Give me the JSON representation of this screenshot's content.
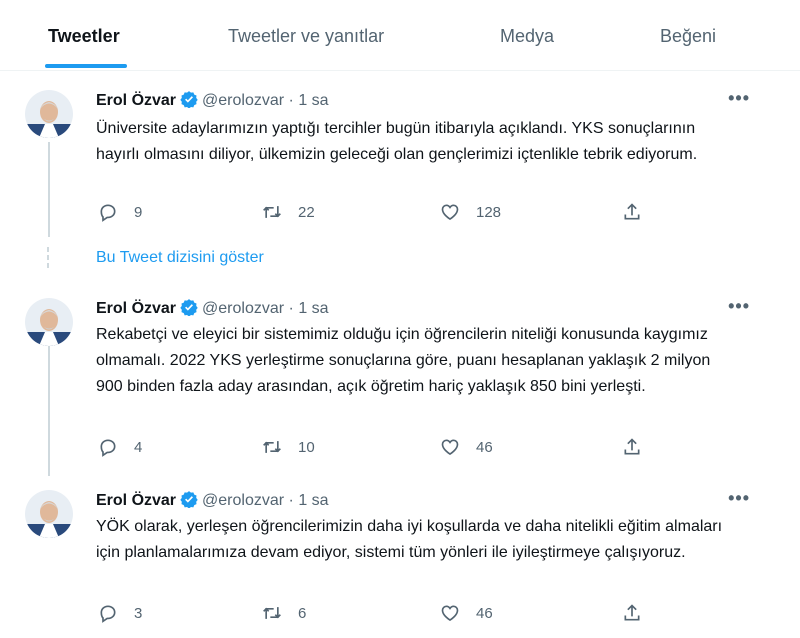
{
  "tabs": [
    {
      "label": "Tweetler",
      "active": true
    },
    {
      "label": "Tweetler ve yanıtlar",
      "active": false
    },
    {
      "label": "Medya",
      "active": false
    },
    {
      "label": "Beğeni",
      "active": false
    }
  ],
  "show_thread_label": "Bu Tweet dizisini göster",
  "more_label": "•••",
  "tweets": [
    {
      "author": "Erol Özvar",
      "handle": "@erolozvar",
      "sep": "·",
      "time": "1 sa",
      "text": "Üniversite adaylarımızın yaptığı tercihler bugün itibarıyla açıklandı. YKS sonuçlarının hayırlı olmasını diliyor, ülkemizin geleceği olan gençlerimizi içtenlikle tebrik ediyorum.",
      "replies": "9",
      "retweets": "22",
      "likes": "128"
    },
    {
      "author": "Erol Özvar",
      "handle": "@erolozvar",
      "sep": "·",
      "time": "1 sa",
      "text": "Rekabetçi ve eleyici bir sistemimiz olduğu için öğrencilerin niteliği konusunda kaygımız olmamalı. 2022 YKS yerleştirme sonuçlarına göre, puanı hesaplanan yaklaşık 2 milyon 900 binden fazla aday arasından, açık öğretim hariç yaklaşık 850 bini yerleşti.",
      "replies": "4",
      "retweets": "10",
      "likes": "46"
    },
    {
      "author": "Erol Özvar",
      "handle": "@erolozvar",
      "sep": "·",
      "time": "1 sa",
      "text": "YÖK olarak, yerleşen öğrencilerimizin daha iyi koşullarda ve daha nitelikli eğitim almaları için planlamalarımıza devam ediyor, sistemi tüm yönleri ile iyileştirmeye çalışıyoruz.",
      "replies": "3",
      "retweets": "6",
      "likes": "46"
    }
  ],
  "colors": {
    "accent": "#1d9bf0",
    "muted": "#536471",
    "text": "#0f1419"
  }
}
